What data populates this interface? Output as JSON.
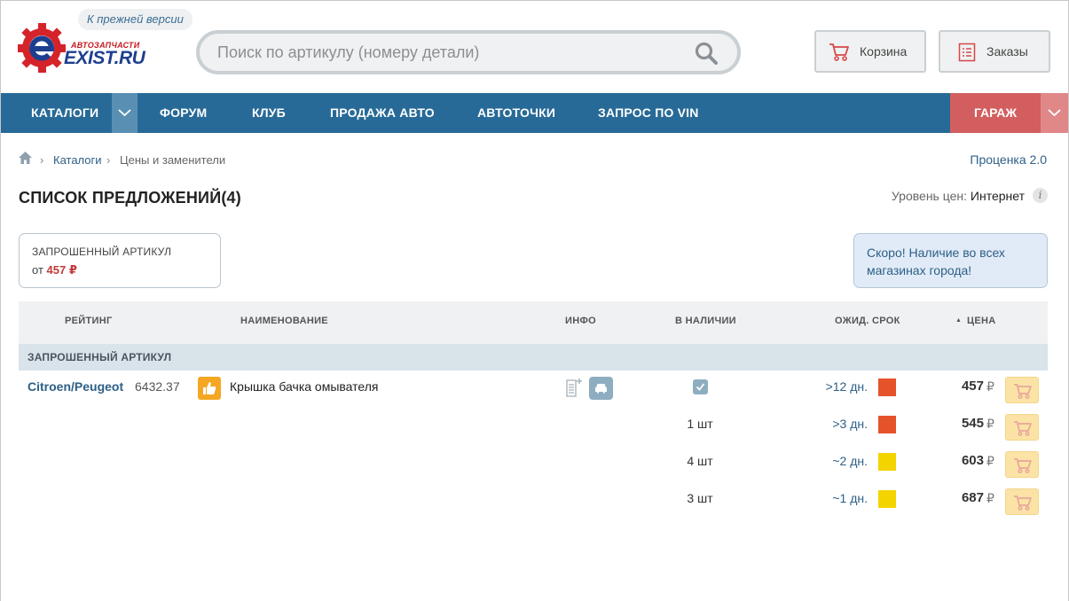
{
  "header": {
    "prev_version": "К прежней версии",
    "logo_small": "АВТОЗАПЧАСТИ",
    "logo_big": "EXIST.RU",
    "search_placeholder": "Поиск по артикулу (номеру детали)",
    "cart_label": "Корзина",
    "orders_label": "Заказы"
  },
  "nav": {
    "items": [
      "КАТАЛОГИ",
      "ФОРУМ",
      "КЛУБ",
      "ПРОДАЖА АВТО",
      "АВТОТОЧКИ",
      "ЗАПРОС ПО VIN"
    ],
    "garage": "ГАРАЖ"
  },
  "breadcrumb": {
    "catalogs": "Каталоги",
    "current": "Цены и заменители",
    "sep": "›"
  },
  "prozenka": "Проценка 2.0",
  "page_title": "СПИСОК ПРЕДЛОЖЕНИЙ(4)",
  "price_level": {
    "label": "Уровень цен:",
    "value": "Интернет",
    "info": "i"
  },
  "requested_box": {
    "title": "ЗАПРОШЕННЫЙ АРТИКУЛ",
    "from": "от",
    "price": "457 ₽"
  },
  "promo": "Скоро! Наличие во всех магазинах города!",
  "table": {
    "headers": {
      "rating": "РЕЙТИНГ",
      "name": "НАИМЕНОВАНИЕ",
      "info": "ИНФО",
      "stock": "В НАЛИЧИИ",
      "term": "ОЖИД. СРОК",
      "price": "ЦЕНА",
      "sort_arrow": "▲"
    },
    "group": "ЗАПРОШЕННЫЙ АРТИКУЛ",
    "product": {
      "brand": "Citroen/Peugeot",
      "article": "6432.37",
      "name": "Крышка бачка омывателя"
    },
    "currency": "₽",
    "offers": [
      {
        "stock": "",
        "term": ">12 дн.",
        "color": "#e5532b",
        "price": "457"
      },
      {
        "stock": "1 шт",
        "term": ">3 дн.",
        "color": "#e5532b",
        "price": "545"
      },
      {
        "stock": "4 шт",
        "term": "~2 дн.",
        "color": "#f3d300",
        "price": "603"
      },
      {
        "stock": "3 шт",
        "term": "~1 дн.",
        "color": "#f3d300",
        "price": "687"
      }
    ]
  },
  "colors": {
    "nav": "#276a97",
    "garage": "#d35e5f",
    "accent_red": "#c23a3a",
    "buy": "#fbe3a6"
  }
}
